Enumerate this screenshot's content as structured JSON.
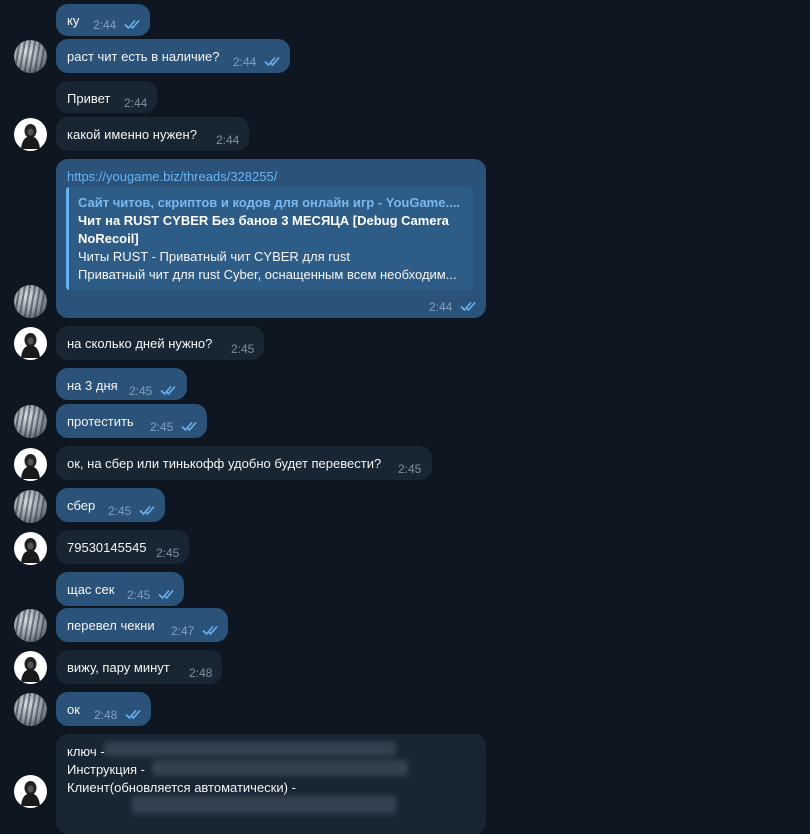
{
  "messages": [
    {
      "id": "m1",
      "text": "ку",
      "time": "2:44",
      "read": true
    },
    {
      "id": "m2",
      "text": "раст чит есть в наличие?",
      "time": "2:44",
      "read": true
    },
    {
      "id": "m3",
      "text": "Привет",
      "time": "2:44"
    },
    {
      "id": "m4",
      "text": "какой именно нужен?",
      "time": "2:44"
    },
    {
      "id": "m5",
      "link": "https://yougame.biz/threads/328255/",
      "time": "2:44",
      "read": true,
      "preview": {
        "site": "Сайт читов, скриптов и кодов для онлайн игр - YouGame....",
        "title_line1": "Чит на RUST CYBER Без банов 3 МЕСЯЦА [Debug Camera",
        "title_line2": "NoRecoil]",
        "desc_line1": "Читы RUST - Приватный чит CYBER для rust",
        "desc_line2": "Приватный чит для rust Cyber, оснащенным всем необходим..."
      }
    },
    {
      "id": "m6",
      "text": "на сколько дней нужно?",
      "time": "2:45"
    },
    {
      "id": "m7",
      "text": "на 3 дня",
      "time": "2:45",
      "read": true
    },
    {
      "id": "m8",
      "text": "протестить",
      "time": "2:45",
      "read": true
    },
    {
      "id": "m9",
      "text": "ок, на сбер или тинькофф удобно будет перевести?",
      "time": "2:45"
    },
    {
      "id": "m10",
      "text": "сбер",
      "time": "2:45",
      "read": true
    },
    {
      "id": "m11",
      "text": "79530145545",
      "time": "2:45"
    },
    {
      "id": "m12",
      "text": "щас сек",
      "time": "2:45",
      "read": true
    },
    {
      "id": "m13",
      "text": "перевел чекни",
      "time": "2:47",
      "read": true
    },
    {
      "id": "m14",
      "text": "вижу, пару минут",
      "time": "2:48"
    },
    {
      "id": "m15",
      "text": "ок",
      "time": "2:48",
      "read": true
    },
    {
      "id": "m16",
      "line1": "ключ -",
      "line2": "Инструкция -",
      "line3": "Клиент(обновляется автоматически) -"
    }
  ],
  "colors": {
    "background": "#0e1621",
    "outgoing_bubble": "#2b5278",
    "incoming_bubble": "#182533",
    "link": "#6ab3f3",
    "read_ticks": "#6ab3f3"
  },
  "icons": {
    "read_receipt": "double-check-icon",
    "avatar_me": "grayscale-photo-avatar",
    "avatar_contact": "dark-figure-avatar"
  }
}
